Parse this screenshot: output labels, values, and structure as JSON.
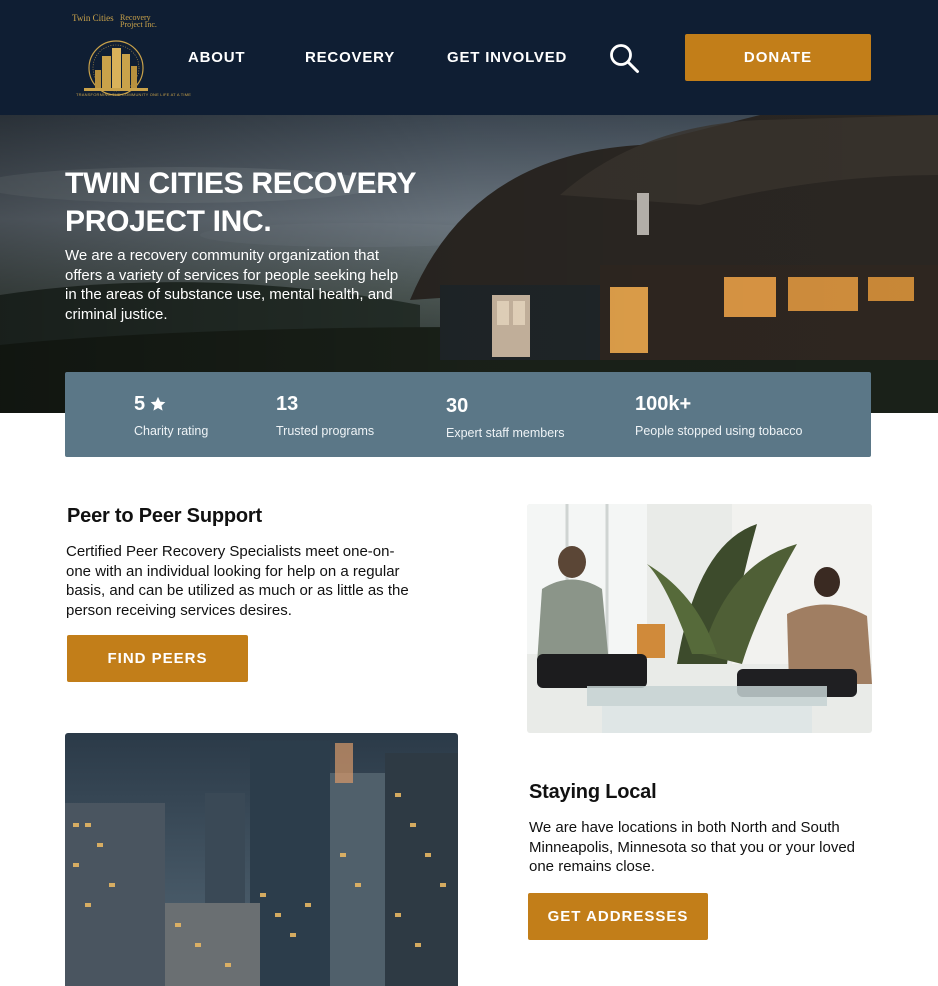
{
  "brand": {
    "logo_top_left": "Twin Cities",
    "logo_top_right": "Recovery Project Inc.",
    "logo_tagline": "TRANSFORMING THE COMMUNITY ONE LIFE AT A TIME",
    "colors": {
      "navy": "#0f1e33",
      "accent": "#c27e19",
      "stats_bg": "#5b7787",
      "gold": "#c9a24a"
    }
  },
  "nav": {
    "about": "ABOUT",
    "recovery": "RECOVERY",
    "get_involved": "GET INVOLVED",
    "search_icon": "search-icon",
    "donate": "DONATE"
  },
  "hero": {
    "title": "TWIN CITIES RECOVERY PROJECT INC.",
    "description": "We are a recovery community organization that offers a variety of services for people seeking help in the areas of substance use, mental health, and criminal justice."
  },
  "stats": [
    {
      "value": "5",
      "label": "Charity rating",
      "icon": "star-icon"
    },
    {
      "value": "13",
      "label": "Trusted programs"
    },
    {
      "value": "30",
      "label": "Expert staff members"
    },
    {
      "value": "100k+",
      "label": "People stopped using tobacco"
    }
  ],
  "peer": {
    "title": "Peer to Peer Support",
    "text": "Certified Peer Recovery Specialists meet one-on-one with an individual looking for help on a regular basis, and can be utilized as much or as little as the person receiving services desires.",
    "button": "FIND PEERS"
  },
  "local": {
    "title": "Staying Local",
    "text": "We are have locations in both North and South Minneapolis, Minnesota so that you or your loved one remains close.",
    "button": "GET ADDRESSES"
  }
}
